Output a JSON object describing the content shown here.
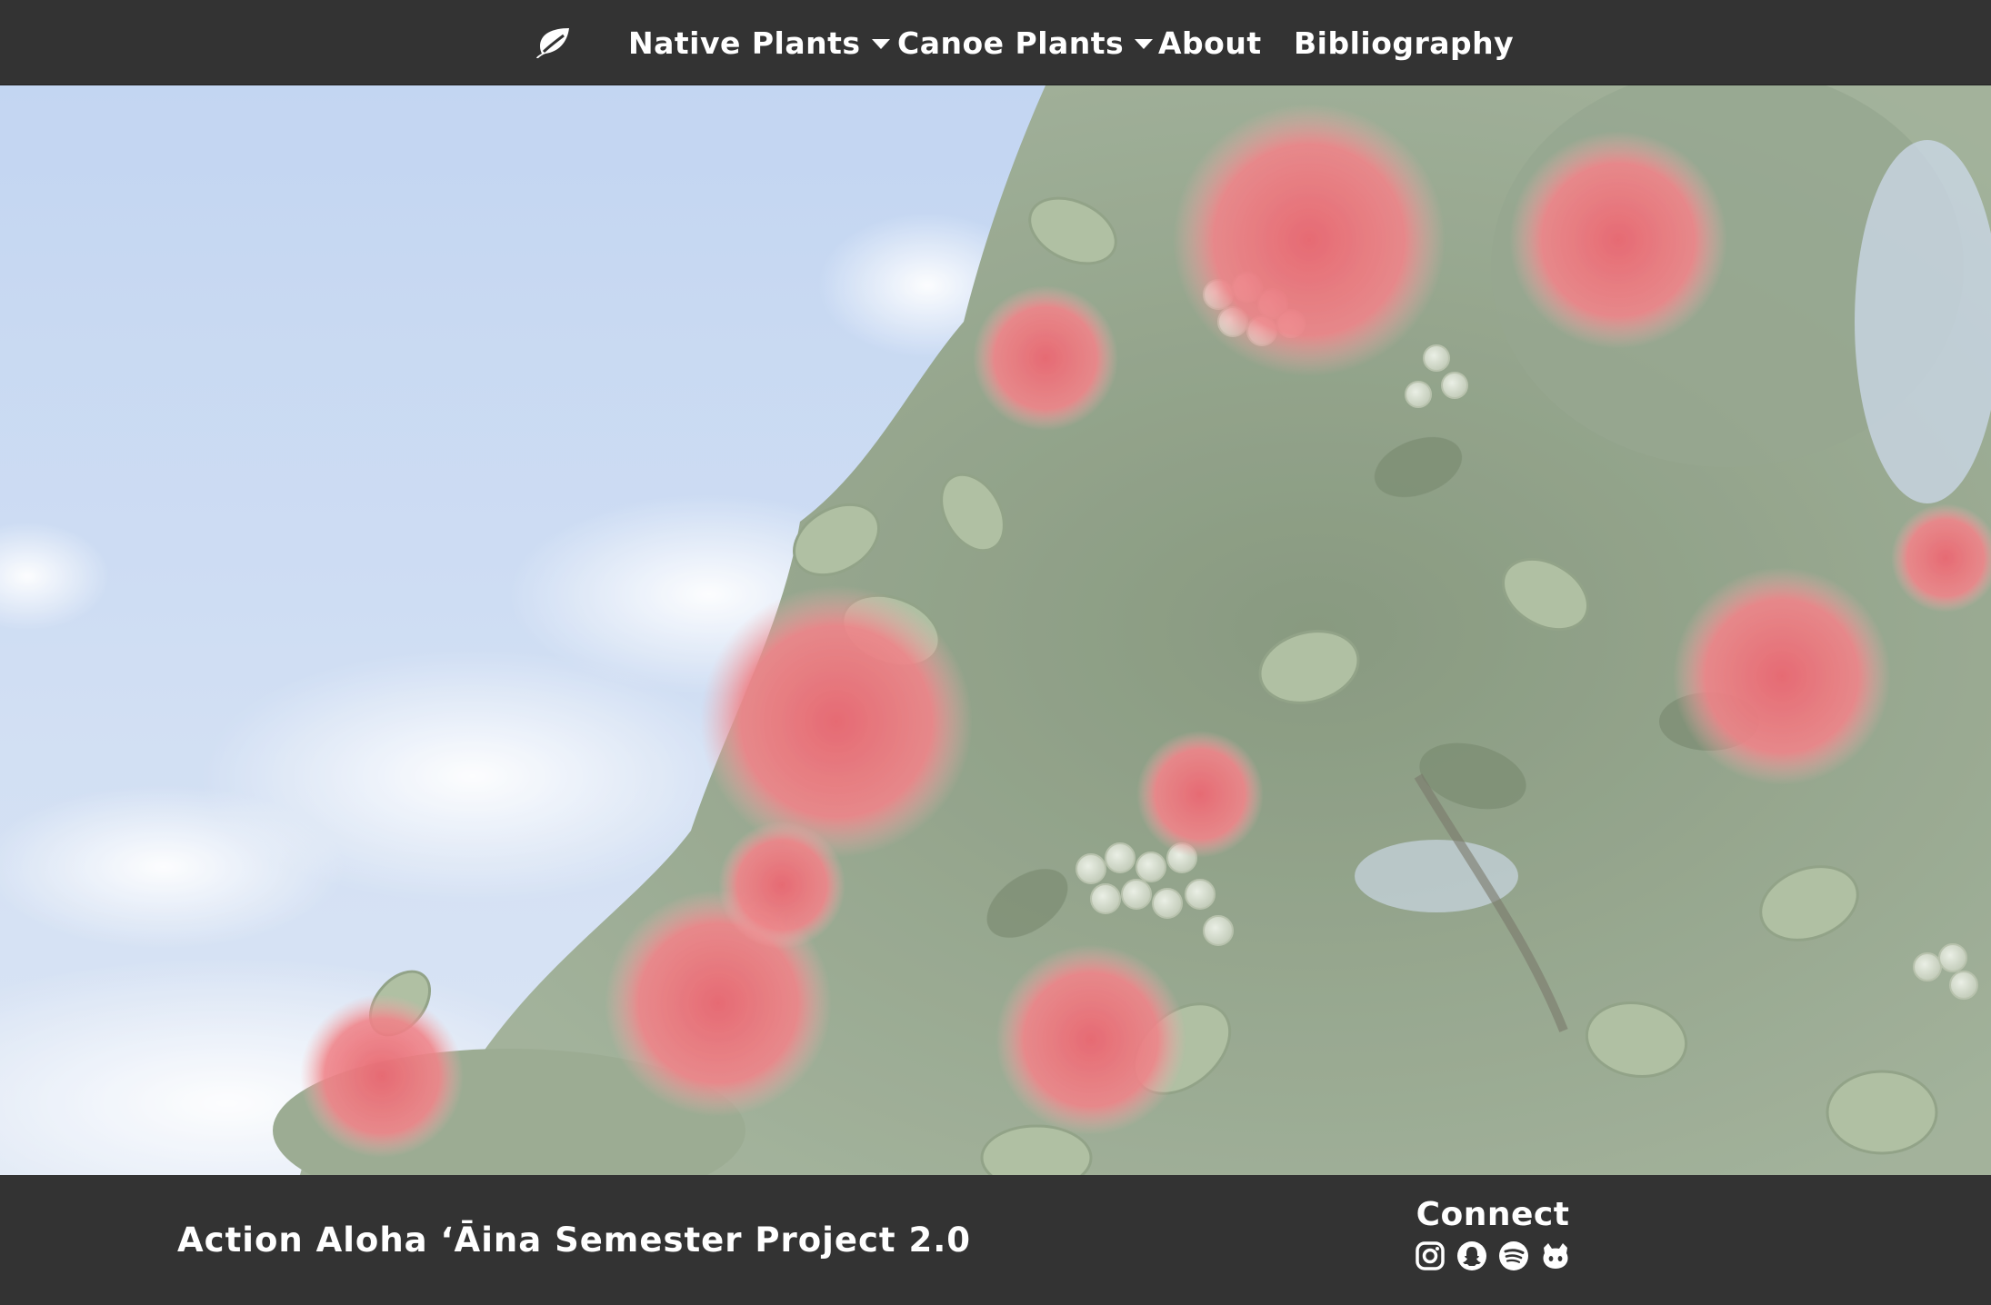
{
  "nav": {
    "brand_icon": "leaf-icon",
    "items": [
      {
        "label": "Native Plants",
        "has_dropdown": true
      },
      {
        "label": "Canoe Plants",
        "has_dropdown": true
      },
      {
        "label": "About",
        "has_dropdown": false
      },
      {
        "label": "Bibliography",
        "has_dropdown": false
      }
    ]
  },
  "footer": {
    "title": "Action Aloha ʻĀina Semester Project 2.0",
    "connect_heading": "Connect",
    "social_icons": [
      "instagram-icon",
      "snapchat-icon",
      "spotify-icon",
      "github-icon"
    ]
  },
  "colors": {
    "bar_background": "#333333",
    "text": "#ffffff",
    "flower_red": "#e8606a",
    "sky": "#bcd0ee"
  }
}
